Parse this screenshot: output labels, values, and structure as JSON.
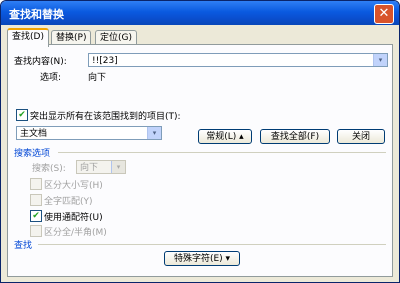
{
  "window": {
    "title": "查找和替换",
    "close_glyph": "✕"
  },
  "tabs": [
    "查找(D)",
    "替换(P)",
    "定位(G)"
  ],
  "find": {
    "label": "查找内容(N):",
    "value": "!![23]",
    "options_label": "选项:",
    "options_value": "向下"
  },
  "highlight": {
    "checkbox_label": "突出显示所有在该范围找到的项目(T):",
    "checked": true,
    "scope_value": "主文档"
  },
  "buttons": {
    "normal": "常规(L) ▴",
    "find_all": "查找全部(F)",
    "close": "关闭"
  },
  "search_options": {
    "section_title": "搜索选项",
    "search_label": "搜索(S):",
    "search_value": "向下",
    "items": [
      {
        "label": "区分大小写(H)",
        "checked": false,
        "enabled": false
      },
      {
        "label": "全字匹配(Y)",
        "checked": false,
        "enabled": false
      },
      {
        "label": "使用通配符(U)",
        "checked": true,
        "enabled": true
      },
      {
        "label": "区分全/半角(M)",
        "checked": false,
        "enabled": false
      }
    ]
  },
  "find_section": {
    "title": "查找",
    "special_button": "特殊字符(E) ▾"
  },
  "icons": {
    "dropdown": "▾",
    "check": "✔"
  }
}
